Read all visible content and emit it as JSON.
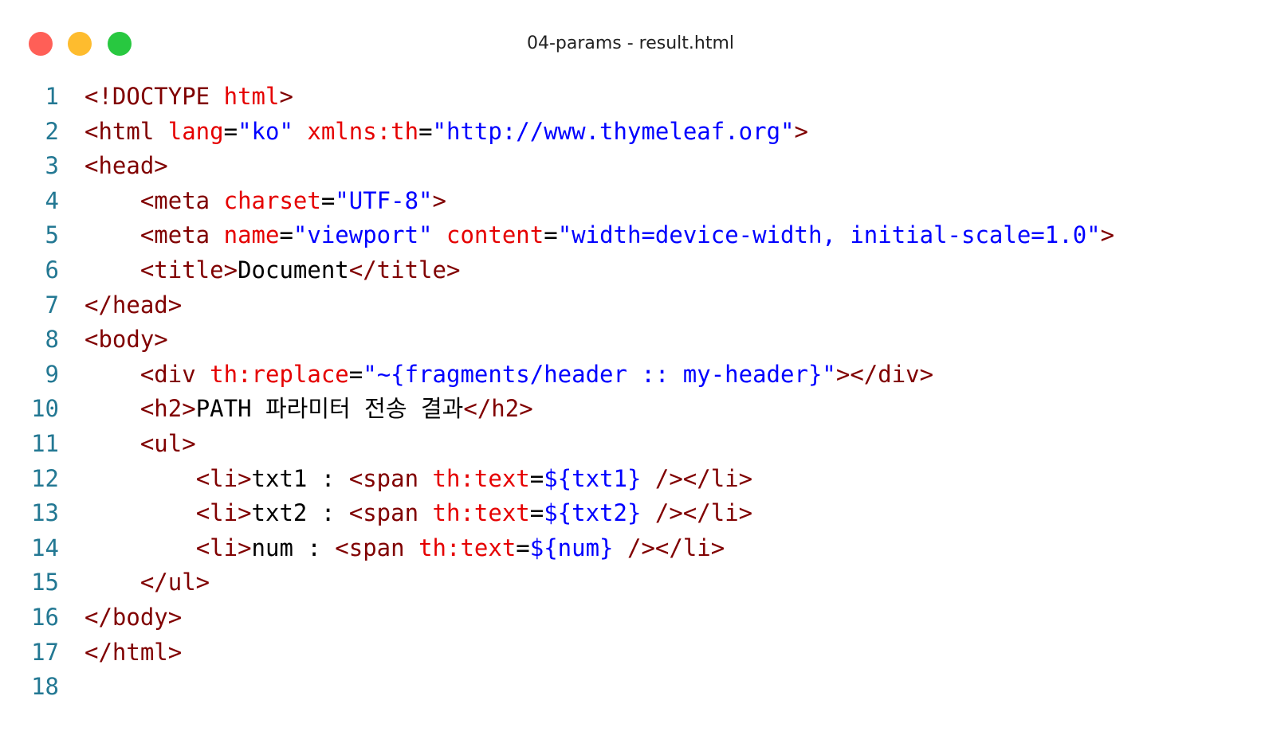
{
  "window": {
    "title": "04-params - result.html"
  },
  "colors": {
    "close": "#ff5f57",
    "minimize": "#febc2e",
    "maximize": "#28c840",
    "line_number": "#237893",
    "tag": "#800000",
    "attribute": "#e50000",
    "value": "#0000ff",
    "text": "#000000"
  },
  "code": {
    "lines": [
      {
        "n": "1",
        "tokens": [
          [
            "t",
            "<!DOCTYPE "
          ],
          [
            "a",
            "html"
          ],
          [
            "t",
            ">"
          ]
        ]
      },
      {
        "n": "2",
        "tokens": [
          [
            "t",
            "<html "
          ],
          [
            "a",
            "lang"
          ],
          [
            "x",
            "="
          ],
          [
            "v",
            "\"ko\""
          ],
          [
            "x",
            " "
          ],
          [
            "a",
            "xmlns:th"
          ],
          [
            "x",
            "="
          ],
          [
            "v",
            "\"http://www.thymeleaf.org\""
          ],
          [
            "t",
            ">"
          ]
        ]
      },
      {
        "n": "3",
        "tokens": [
          [
            "t",
            "<head>"
          ]
        ]
      },
      {
        "n": "4",
        "tokens": [
          [
            "x",
            "    "
          ],
          [
            "t",
            "<meta "
          ],
          [
            "a",
            "charset"
          ],
          [
            "x",
            "="
          ],
          [
            "v",
            "\"UTF-8\""
          ],
          [
            "t",
            ">"
          ]
        ]
      },
      {
        "n": "5",
        "tokens": [
          [
            "x",
            "    "
          ],
          [
            "t",
            "<meta "
          ],
          [
            "a",
            "name"
          ],
          [
            "x",
            "="
          ],
          [
            "v",
            "\"viewport\""
          ],
          [
            "x",
            " "
          ],
          [
            "a",
            "content"
          ],
          [
            "x",
            "="
          ],
          [
            "v",
            "\"width=device-width, initial-scale=1.0\""
          ],
          [
            "t",
            ">"
          ]
        ]
      },
      {
        "n": "6",
        "tokens": [
          [
            "x",
            "    "
          ],
          [
            "t",
            "<title>"
          ],
          [
            "x",
            "Document"
          ],
          [
            "t",
            "</title>"
          ]
        ]
      },
      {
        "n": "7",
        "tokens": [
          [
            "t",
            "</head>"
          ]
        ]
      },
      {
        "n": "8",
        "tokens": [
          [
            "t",
            "<body>"
          ]
        ]
      },
      {
        "n": "9",
        "tokens": [
          [
            "x",
            "    "
          ],
          [
            "t",
            "<div "
          ],
          [
            "a",
            "th:replace"
          ],
          [
            "x",
            "="
          ],
          [
            "v",
            "\"~{fragments/header :: my-header}\""
          ],
          [
            "t",
            "></div>"
          ]
        ]
      },
      {
        "n": "10",
        "tokens": [
          [
            "x",
            "    "
          ],
          [
            "t",
            "<h2>"
          ],
          [
            "x",
            "PATH 파라미터 전송 결과"
          ],
          [
            "t",
            "</h2>"
          ]
        ]
      },
      {
        "n": "11",
        "tokens": [
          [
            "x",
            "    "
          ],
          [
            "t",
            "<ul>"
          ]
        ]
      },
      {
        "n": "12",
        "tokens": [
          [
            "x",
            "        "
          ],
          [
            "t",
            "<li>"
          ],
          [
            "x",
            "txt1 : "
          ],
          [
            "t",
            "<span "
          ],
          [
            "a",
            "th:text"
          ],
          [
            "x",
            "="
          ],
          [
            "v",
            "${txt1}"
          ],
          [
            "x",
            " "
          ],
          [
            "t",
            "/></li>"
          ]
        ]
      },
      {
        "n": "13",
        "tokens": [
          [
            "x",
            "        "
          ],
          [
            "t",
            "<li>"
          ],
          [
            "x",
            "txt2 : "
          ],
          [
            "t",
            "<span "
          ],
          [
            "a",
            "th:text"
          ],
          [
            "x",
            "="
          ],
          [
            "v",
            "${txt2}"
          ],
          [
            "x",
            " "
          ],
          [
            "t",
            "/></li>"
          ]
        ]
      },
      {
        "n": "14",
        "tokens": [
          [
            "x",
            "        "
          ],
          [
            "t",
            "<li>"
          ],
          [
            "x",
            "num : "
          ],
          [
            "t",
            "<span "
          ],
          [
            "a",
            "th:text"
          ],
          [
            "x",
            "="
          ],
          [
            "v",
            "${num}"
          ],
          [
            "x",
            " "
          ],
          [
            "t",
            "/></li>"
          ]
        ]
      },
      {
        "n": "15",
        "tokens": [
          [
            "x",
            "    "
          ],
          [
            "t",
            "</ul>"
          ]
        ]
      },
      {
        "n": "16",
        "tokens": [
          [
            "t",
            "</body>"
          ]
        ]
      },
      {
        "n": "17",
        "tokens": [
          [
            "t",
            "</html>"
          ]
        ]
      },
      {
        "n": "18",
        "tokens": []
      }
    ]
  }
}
